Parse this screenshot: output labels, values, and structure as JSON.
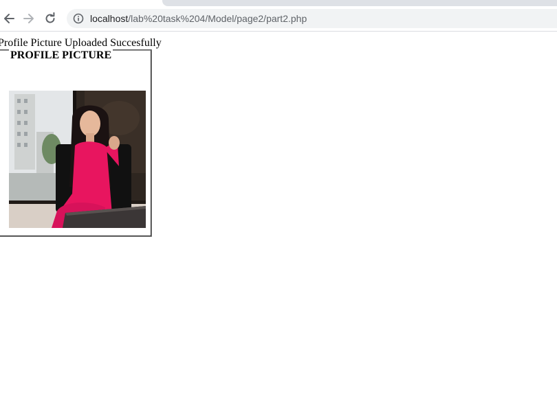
{
  "browser": {
    "url_host": "localhost",
    "url_path": "/lab%20task%204/Model/page2/part2.php"
  },
  "icons": {
    "back": "arrow-left-icon",
    "forward": "arrow-right-icon",
    "reload": "reload-icon",
    "site_info": "info-icon"
  },
  "page": {
    "status_message": "Profile Picture Uploaded Succesfully",
    "fieldset_legend": "PROFILE PICTURE"
  },
  "colors": {
    "omnibox_bg": "#f1f3f4",
    "dress": "#e8155f",
    "hair": "#1b1212"
  }
}
